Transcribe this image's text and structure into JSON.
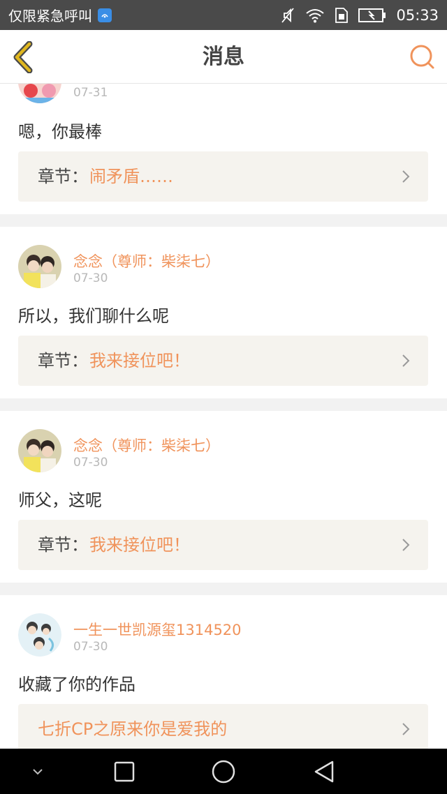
{
  "status_bar": {
    "carrier": "仅限紧急呼叫",
    "time": "05:33",
    "icons": [
      "sim-icon",
      "mute-icon",
      "wifi-icon",
      "sim-status-icon",
      "battery-icon"
    ]
  },
  "header": {
    "title": "消息",
    "back_icon": "chevron-left-icon",
    "search_icon": "search-icon",
    "accent_color": "#f0935b",
    "back_color": "#e0b71f"
  },
  "messages": [
    {
      "author": "",
      "date": "07-31",
      "text": "嗯，你最棒",
      "chapter_label": "章节：",
      "chapter_title": "闹矛盾……"
    },
    {
      "author": "念念（尊师：柴柒七）",
      "date": "07-30",
      "text": "所以，我们聊什么呢",
      "chapter_label": "章节：",
      "chapter_title": "我来接位吧！"
    },
    {
      "author": "念念（尊师：柴柒七）",
      "date": "07-30",
      "text": "师父，这呢",
      "chapter_label": "章节：",
      "chapter_title": "我来接位吧！"
    },
    {
      "author": "一生一世凯源玺1314520",
      "date": "07-30",
      "text": "收藏了你的作品",
      "chapter_label": "",
      "chapter_title": "七折CP之原来你是爱我的"
    }
  ],
  "nav_bar": {
    "icons": [
      "collapse-icon",
      "recents-icon",
      "home-icon",
      "back-icon"
    ]
  }
}
